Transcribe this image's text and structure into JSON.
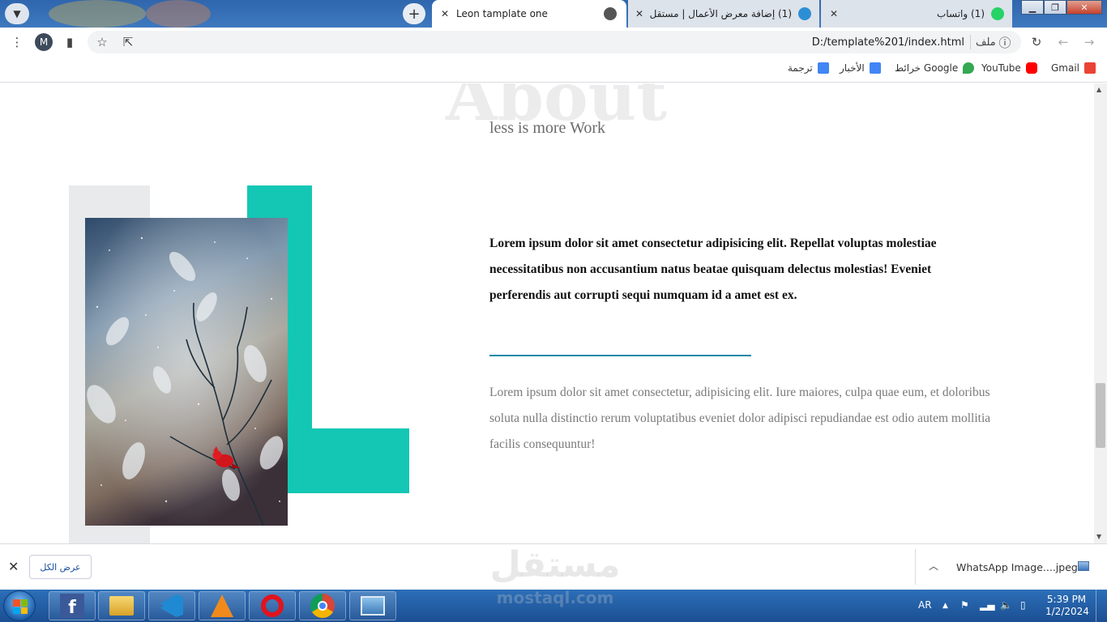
{
  "browser": {
    "tabs": [
      {
        "title": "Leon tamplate one",
        "active": true
      },
      {
        "title": "(1) إضافة معرض الأعمال | مستقل",
        "active": false
      },
      {
        "title": "(1) واتساب",
        "active": false
      }
    ],
    "url": "D:/template%201/index.html",
    "file_label": "ملف",
    "avatar_letter": "M",
    "new_tab_symbol": "+",
    "bookmarks": [
      {
        "label": "Gmail",
        "color": "#EA4335"
      },
      {
        "label": "YouTube",
        "color": "#FF0000"
      },
      {
        "label": "خرائط Google",
        "color": "#34A853"
      },
      {
        "label": "الأخبار",
        "color": "#4285F4"
      },
      {
        "label": "ترجمة",
        "color": "#4285F4"
      }
    ]
  },
  "page": {
    "about_heading": "About",
    "subtitle": "less is more Work",
    "lead_text": "Lorem ipsum dolor sit amet consectetur adipisicing elit. Repellat voluptas molestiae necessitatibus non accusantium natus beatae quisquam delectus molestias! Eveniet perferendis aut corrupti sequi numquam id a amet est ex.",
    "body_text": "Lorem ipsum dolor sit amet consectetur, adipisicing elit. Iure maiores, culpa quae eum, et doloribus soluta nulla distinctio rerum voluptatibus eveniet dolor adipisci repudiandae est odio autem mollitia facilis consequuntur!",
    "accent_color": "#14C7B4",
    "divider_color": "#1E8AA8"
  },
  "downloads": {
    "show_all_label": "عرض الكل",
    "file_name": "WhatsApp Image....jpeg",
    "watermark_arabic": "مستقل",
    "watermark_url": "mostaql.com"
  },
  "taskbar": {
    "language": "AR",
    "time": "5:39 PM",
    "date": "1/2/2024",
    "apps": [
      "facebook",
      "file-explorer",
      "vscode",
      "vlc",
      "opera",
      "chrome",
      "photo-viewer"
    ]
  }
}
